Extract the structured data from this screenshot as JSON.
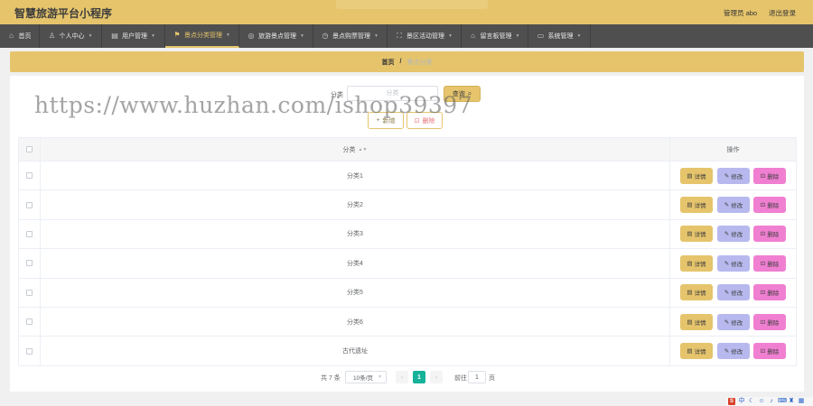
{
  "header": {
    "title": "智慧旅游平台小程序",
    "admin_label": "管理员 abo",
    "logout_label": "退出登录"
  },
  "nav": {
    "items": [
      {
        "label": "首页",
        "icon": "home-icon"
      },
      {
        "label": "个人中心",
        "icon": "user-icon"
      },
      {
        "label": "用户管理",
        "icon": "document-icon"
      },
      {
        "label": "景点分类管理",
        "icon": "flag-icon",
        "active": true
      },
      {
        "label": "旅游景点管理",
        "icon": "compass-icon"
      },
      {
        "label": "景点购票管理",
        "icon": "clock-icon"
      },
      {
        "label": "景区活动管理",
        "icon": "expand-icon"
      },
      {
        "label": "留言板管理",
        "icon": "bank-icon"
      },
      {
        "label": "系统管理",
        "icon": "monitor-icon"
      }
    ]
  },
  "breadcrumb": {
    "home": "首页",
    "separator": "/",
    "current": "景点分类"
  },
  "search": {
    "label": "分类",
    "placeholder": "分类",
    "query_label": "查询"
  },
  "actions": {
    "add_label": "新增",
    "delete_label": "删除"
  },
  "watermark": "https://www.huzhan.com/ishop39397",
  "table": {
    "headers": {
      "category": "分类",
      "operation": "操作"
    },
    "row_actions": {
      "detail": "详情",
      "edit": "修改",
      "delete": "删除"
    },
    "rows": [
      {
        "category": "分类1"
      },
      {
        "category": "分类2"
      },
      {
        "category": "分类3"
      },
      {
        "category": "分类4"
      },
      {
        "category": "分类5"
      },
      {
        "category": "分类6"
      },
      {
        "category": "古代遗址"
      }
    ]
  },
  "pagination": {
    "total_label": "共 7 条",
    "page_size_label": "10条/页",
    "prev": "‹",
    "current_page": "1",
    "next": "›",
    "goto_label": "前往",
    "goto_value": "1",
    "page_suffix": "页"
  },
  "colors": {
    "accent": "#e5c46c",
    "nav_bg": "#4f4f4f",
    "edit": "#b7b9ee",
    "delete": "#f07fd1",
    "pager_active": "#16b29a"
  }
}
